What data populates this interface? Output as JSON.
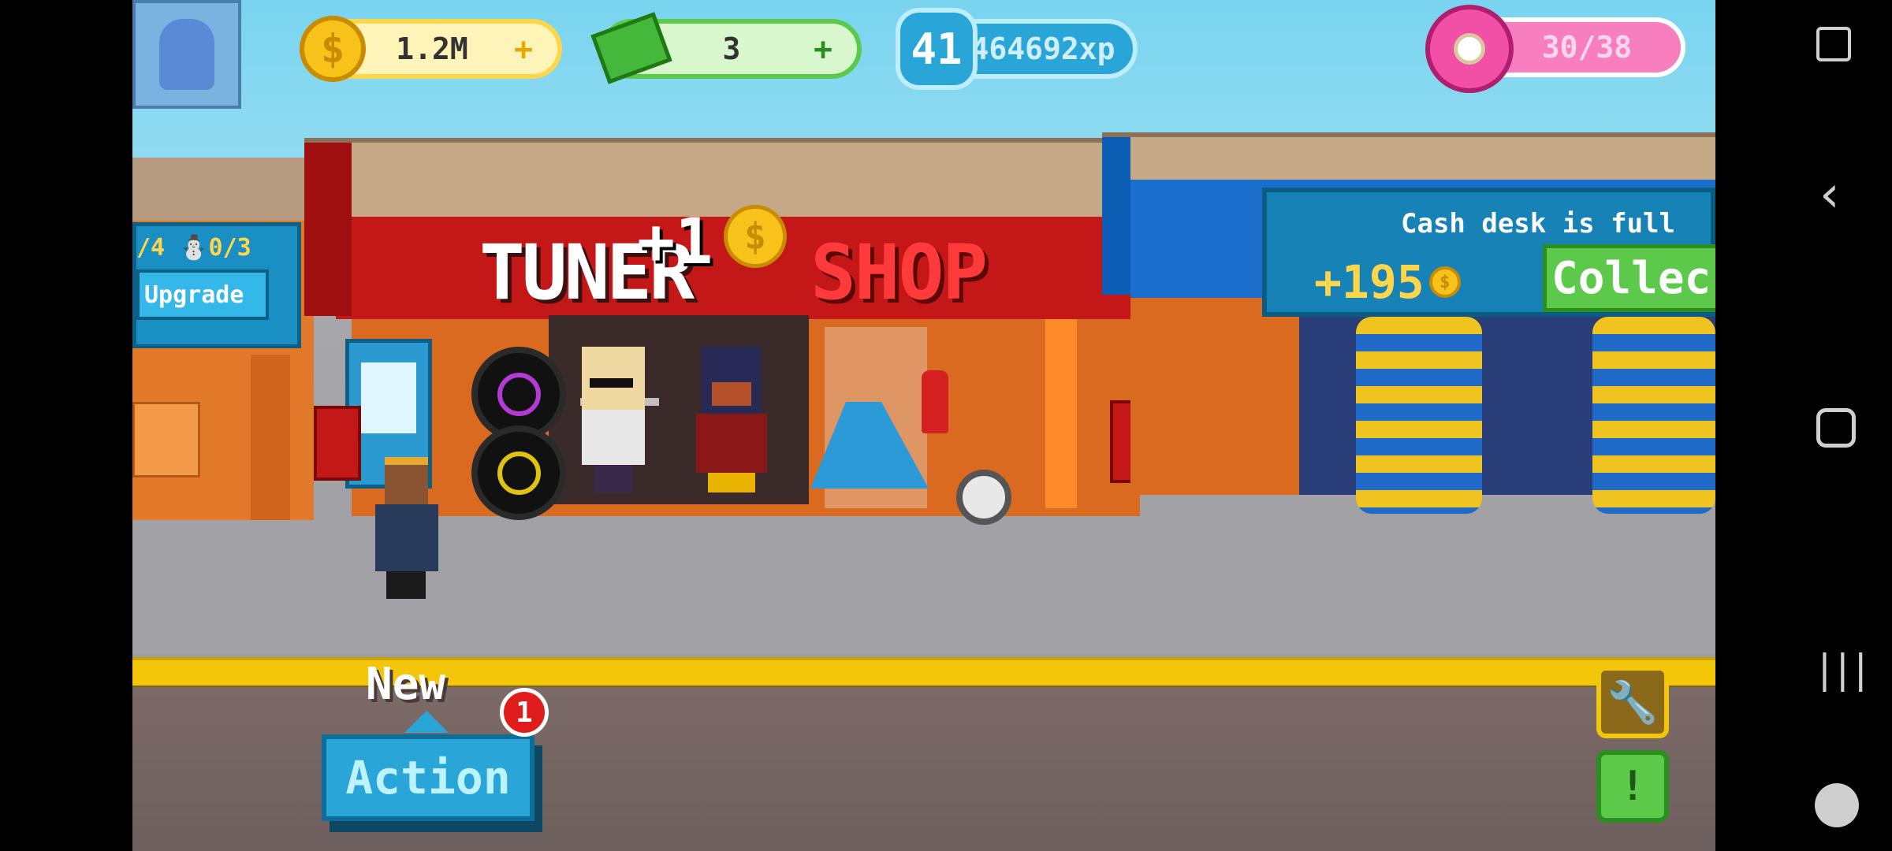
{
  "hud": {
    "coins": "1.2M",
    "cash": "3",
    "level": "41",
    "xp": "464692xp",
    "donuts": "30/38",
    "plus": "+"
  },
  "tuner_shop": {
    "sign_left": "TUNER",
    "sign_right": "SHOP",
    "floating_counter": "+1"
  },
  "left_building": {
    "stats": "/4 ⛄0/3",
    "upgrade_label": "Upgrade"
  },
  "cash_desk": {
    "message": "Cash desk is full",
    "amount": "+195",
    "collect_label": "Collec"
  },
  "bottom_bar": {
    "new_label": "New",
    "action_label": "Action",
    "notification_count": "1"
  },
  "colors": {
    "sky": "#79d4ef",
    "coin_gold": "#f7c21a",
    "cash_green": "#5cc94a",
    "xp_blue": "#2aa5d8",
    "donut_pink": "#f24fa6",
    "shop_red": "#c41818"
  }
}
